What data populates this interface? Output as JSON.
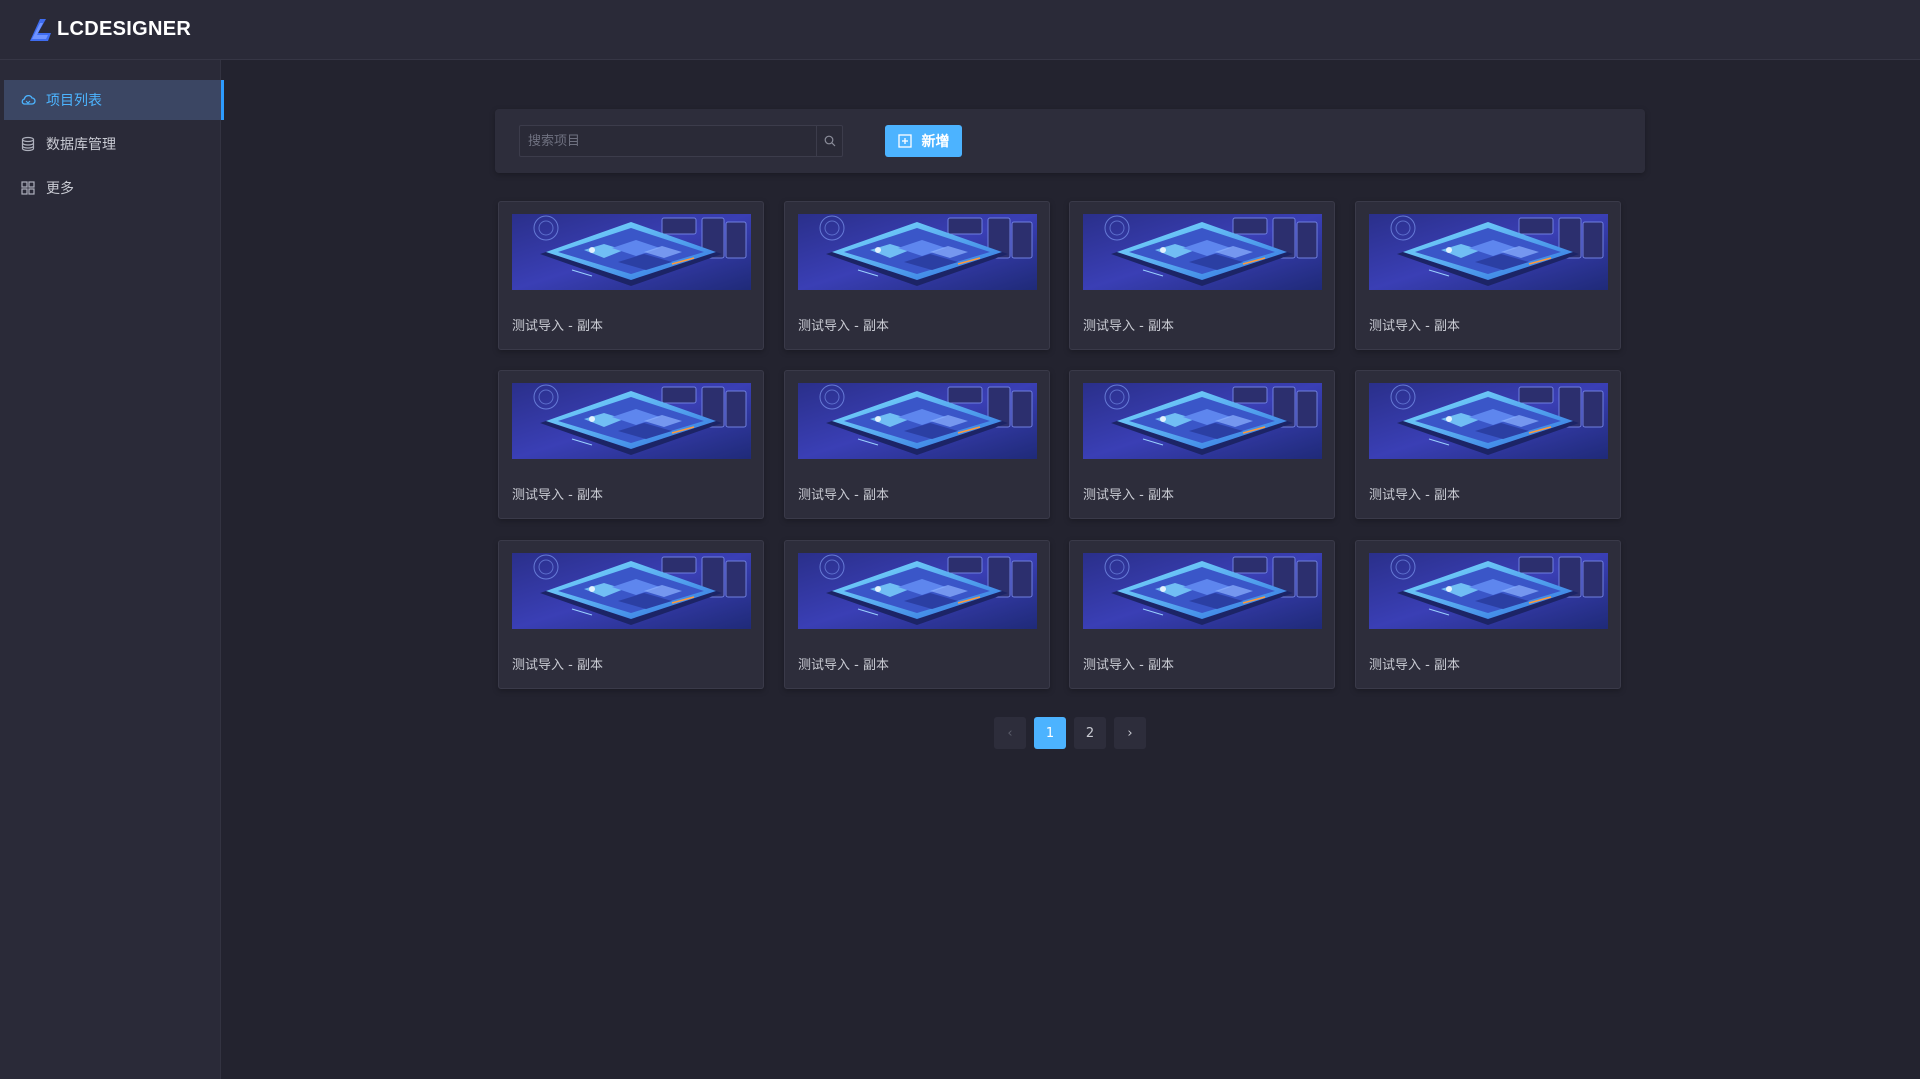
{
  "app": {
    "logo_text": "LCDESIGNER",
    "accent_color": "#4cb3ff"
  },
  "sidebar": {
    "items": [
      {
        "label": "项目列表",
        "icon": "cloud-icon",
        "active": true
      },
      {
        "label": "数据库管理",
        "icon": "database-icon",
        "active": false
      },
      {
        "label": "更多",
        "icon": "grid-icon",
        "active": false
      }
    ]
  },
  "toolbar": {
    "search_placeholder": "搜索项目",
    "search_value": "",
    "add_label": "新增"
  },
  "projects": [
    {
      "title": "测试导入 - 副本"
    },
    {
      "title": "测试导入 - 副本"
    },
    {
      "title": "测试导入 - 副本"
    },
    {
      "title": "测试导入 - 副本"
    },
    {
      "title": "测试导入 - 副本"
    },
    {
      "title": "测试导入 - 副本"
    },
    {
      "title": "测试导入 - 副本"
    },
    {
      "title": "测试导入 - 副本"
    },
    {
      "title": "测试导入 - 副本"
    },
    {
      "title": "测试导入 - 副本"
    },
    {
      "title": "测试导入 - 副本"
    },
    {
      "title": "测试导入 - 副本"
    }
  ],
  "pagination": {
    "prev": "‹",
    "pages": [
      "1",
      "2"
    ],
    "current": "1",
    "next": "›"
  }
}
